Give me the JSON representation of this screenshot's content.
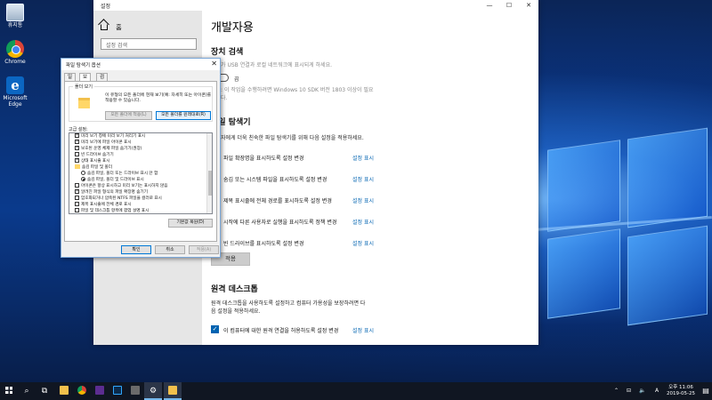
{
  "desktop": {
    "icons": [
      {
        "label": "휴지통"
      },
      {
        "label": "Chrome"
      },
      {
        "label": "Microsoft Edge"
      }
    ]
  },
  "settings": {
    "window_title": "설정",
    "controls": {
      "minimize": "—",
      "maximize": "☐",
      "close": "✕"
    },
    "nav": {
      "home_label": "홈",
      "search_placeholder": "설정 검색"
    },
    "page_title": "개발자용",
    "device_discovery": {
      "heading": "장치 검색",
      "desc": "장치가 USB 연결과 로컬 네트워크에 표시되게 하세요.",
      "toggle_state": "끔",
      "note_line1": "참고: 이 작업을 수행하려면 Windows 10 SDK 버전 1803 이상이 필요",
      "note_line2": "합니다."
    },
    "file_explorer": {
      "heading": "파일 탐색기",
      "desc": "개발자에게 더욱 친숙한 파일 탐색기를 위해 다음 설정을 적용하세요.",
      "show_link": "설정 표시",
      "options": [
        {
          "label": "파일 확장명을 표시하도록 설정 변경",
          "checked": true
        },
        {
          "label": "숨김 또는 시스템 파일을 표시하도록 설정 변경",
          "checked": true
        },
        {
          "label": "제목 표시줄에 전체 경로를 표시하도록 설정 변경",
          "checked": true
        },
        {
          "label": "시작에 다른 사용자로 실행을 표시하도록 정책 변경",
          "checked": true
        },
        {
          "label": "빈 드라이브를 표시하도록 설정 변경",
          "checked": true
        }
      ],
      "apply_label": "적용"
    },
    "remote_desktop": {
      "heading": "원격 데스크톱",
      "desc_line1": "원격 데스크톱을 사용하도록 설정하고 컴퓨터 가용성을 보장하려면 다",
      "desc_line2": "음 설정을 적용하세요.",
      "option_label": "이 컴퓨터에 대한 원격 연결을 허용하도록 설정 변경",
      "show_link": "설정 표시"
    }
  },
  "folder_options": {
    "title": "파일 탐색기 옵션",
    "close": "✕",
    "tabs": [
      "일반",
      "보기",
      "검색"
    ],
    "active_tab": "보기",
    "folder_view": {
      "legend": "폴더 보기",
      "desc": "이 유형의 모든 폴더에 현재 보기(예: 자세히 또는 아이콘)를 적용할 수 있습니다.",
      "apply_btn": "모든 폴더에 적용(L)",
      "reset_btn": "모든 폴더를 원래대로(R)"
    },
    "advanced_label": "고급 설정:",
    "advanced_items": [
      {
        "kind": "check",
        "checked": true,
        "indent": 1,
        "label": "미리 보기 창에 미리 보기 처리기 표시"
      },
      {
        "kind": "check",
        "checked": true,
        "indent": 1,
        "label": "미리 보기에 파일 아이콘 표시"
      },
      {
        "kind": "check",
        "checked": true,
        "indent": 1,
        "label": "보호된 운영 체제 파일 숨기기(권장)"
      },
      {
        "kind": "check",
        "checked": false,
        "indent": 1,
        "label": "빈 드라이브 숨기기"
      },
      {
        "kind": "check",
        "checked": true,
        "indent": 1,
        "label": "상태 표시줄 표시"
      },
      {
        "kind": "folder",
        "checked": false,
        "indent": 1,
        "label": "숨김 파일 및 폴더"
      },
      {
        "kind": "radio",
        "checked": false,
        "indent": 2,
        "label": "숨김 파일, 폴더 또는 드라이브 표시 안 함"
      },
      {
        "kind": "radio",
        "checked": true,
        "indent": 2,
        "label": "숨김 파일, 폴더 및 드라이브 표시"
      },
      {
        "kind": "check",
        "checked": false,
        "indent": 1,
        "label": "아이콘은 항상 표시하고 미리 보기는 표시하지 않음"
      },
      {
        "kind": "check",
        "checked": true,
        "indent": 1,
        "label": "알려진 파일 형식의 파일 확장명 숨기기"
      },
      {
        "kind": "check",
        "checked": false,
        "indent": 1,
        "label": "암호화되거나 압축된 NTFS 파일을 컬러로 표시"
      },
      {
        "kind": "check",
        "checked": false,
        "indent": 1,
        "label": "제목 표시줄에 전체 경로 표시"
      },
      {
        "kind": "check",
        "checked": false,
        "indent": 1,
        "label": "파일 및 데스크톱 항목에 팝업 설명 표시"
      }
    ],
    "restore_btn": "기본값 복원(D)",
    "ok_btn": "확인",
    "cancel_btn": "취소",
    "apply_btn": "적용(A)"
  },
  "taskbar": {
    "start_icon": "windows-start-icon",
    "search_glyph": "⌕",
    "taskview_glyph": "⧉",
    "tray_up": "⌃",
    "network_glyph": "⊟",
    "volume_glyph": "🔈",
    "ime_label": "A",
    "time": "오후 11:06",
    "date": "2019-05-25",
    "notification_glyph": "▤"
  }
}
